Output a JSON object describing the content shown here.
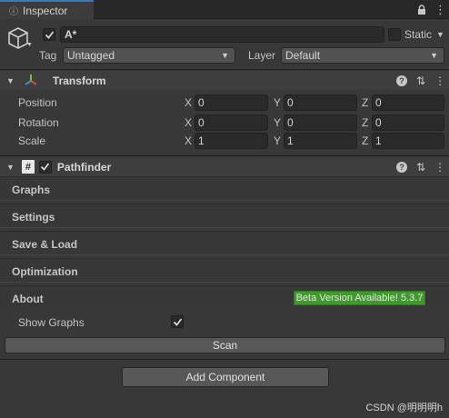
{
  "tab": {
    "title": "Inspector"
  },
  "object": {
    "name": "A*",
    "static_label": "Static",
    "tag_label": "Tag",
    "tag_value": "Untagged",
    "layer_label": "Layer",
    "layer_value": "Default"
  },
  "transform": {
    "title": "Transform",
    "rows": [
      {
        "label": "Position",
        "x": "0",
        "y": "0",
        "z": "0"
      },
      {
        "label": "Rotation",
        "x": "0",
        "y": "0",
        "z": "0"
      },
      {
        "label": "Scale",
        "x": "1",
        "y": "1",
        "z": "1"
      }
    ],
    "axis": {
      "x": "X",
      "y": "Y",
      "z": "Z"
    }
  },
  "pathfinder": {
    "title": "Pathfinder",
    "sections": [
      "Graphs",
      "Settings",
      "Save & Load",
      "Optimization",
      "About"
    ],
    "badge": "Beta Version Available! 5.3.7",
    "show_graphs_label": "Show Graphs",
    "scan_label": "Scan"
  },
  "add_component_label": "Add Component",
  "watermark": "CSDN @明明明h",
  "colors": {
    "accent_tab": "#3a79bb",
    "badge_green": "#3e9a2b"
  }
}
